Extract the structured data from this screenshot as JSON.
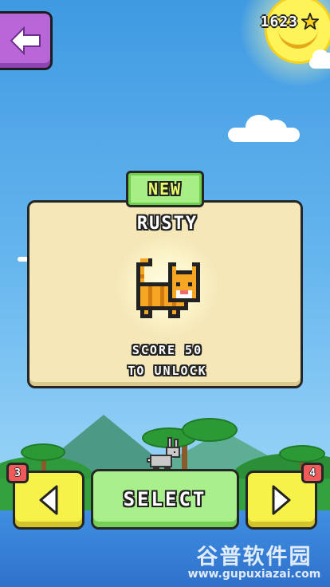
{
  "header": {
    "star_count": "1623",
    "back_icon": "arrow-left-icon",
    "star_icon": "star-icon"
  },
  "character_card": {
    "badge": "NEW",
    "name": "RUSTY",
    "unlock_line_1": "SCORE 50",
    "unlock_line_2": "TO UNLOCK"
  },
  "controls": {
    "prev_count": "3",
    "next_count": "4",
    "select_label": "SELECT",
    "prev_icon": "triangle-left-icon",
    "next_icon": "triangle-right-icon"
  },
  "watermark": {
    "title": "谷普软件园",
    "url": "www.gupuxiazai.com"
  },
  "colors": {
    "sky": "#66b6ee",
    "back_button": "#b866d8",
    "card": "#f5e7b8",
    "new_badge": "#a7ee87",
    "nav_button": "#f6f24a",
    "select_button": "#a9f08d",
    "count_badge": "#f05a5a"
  }
}
